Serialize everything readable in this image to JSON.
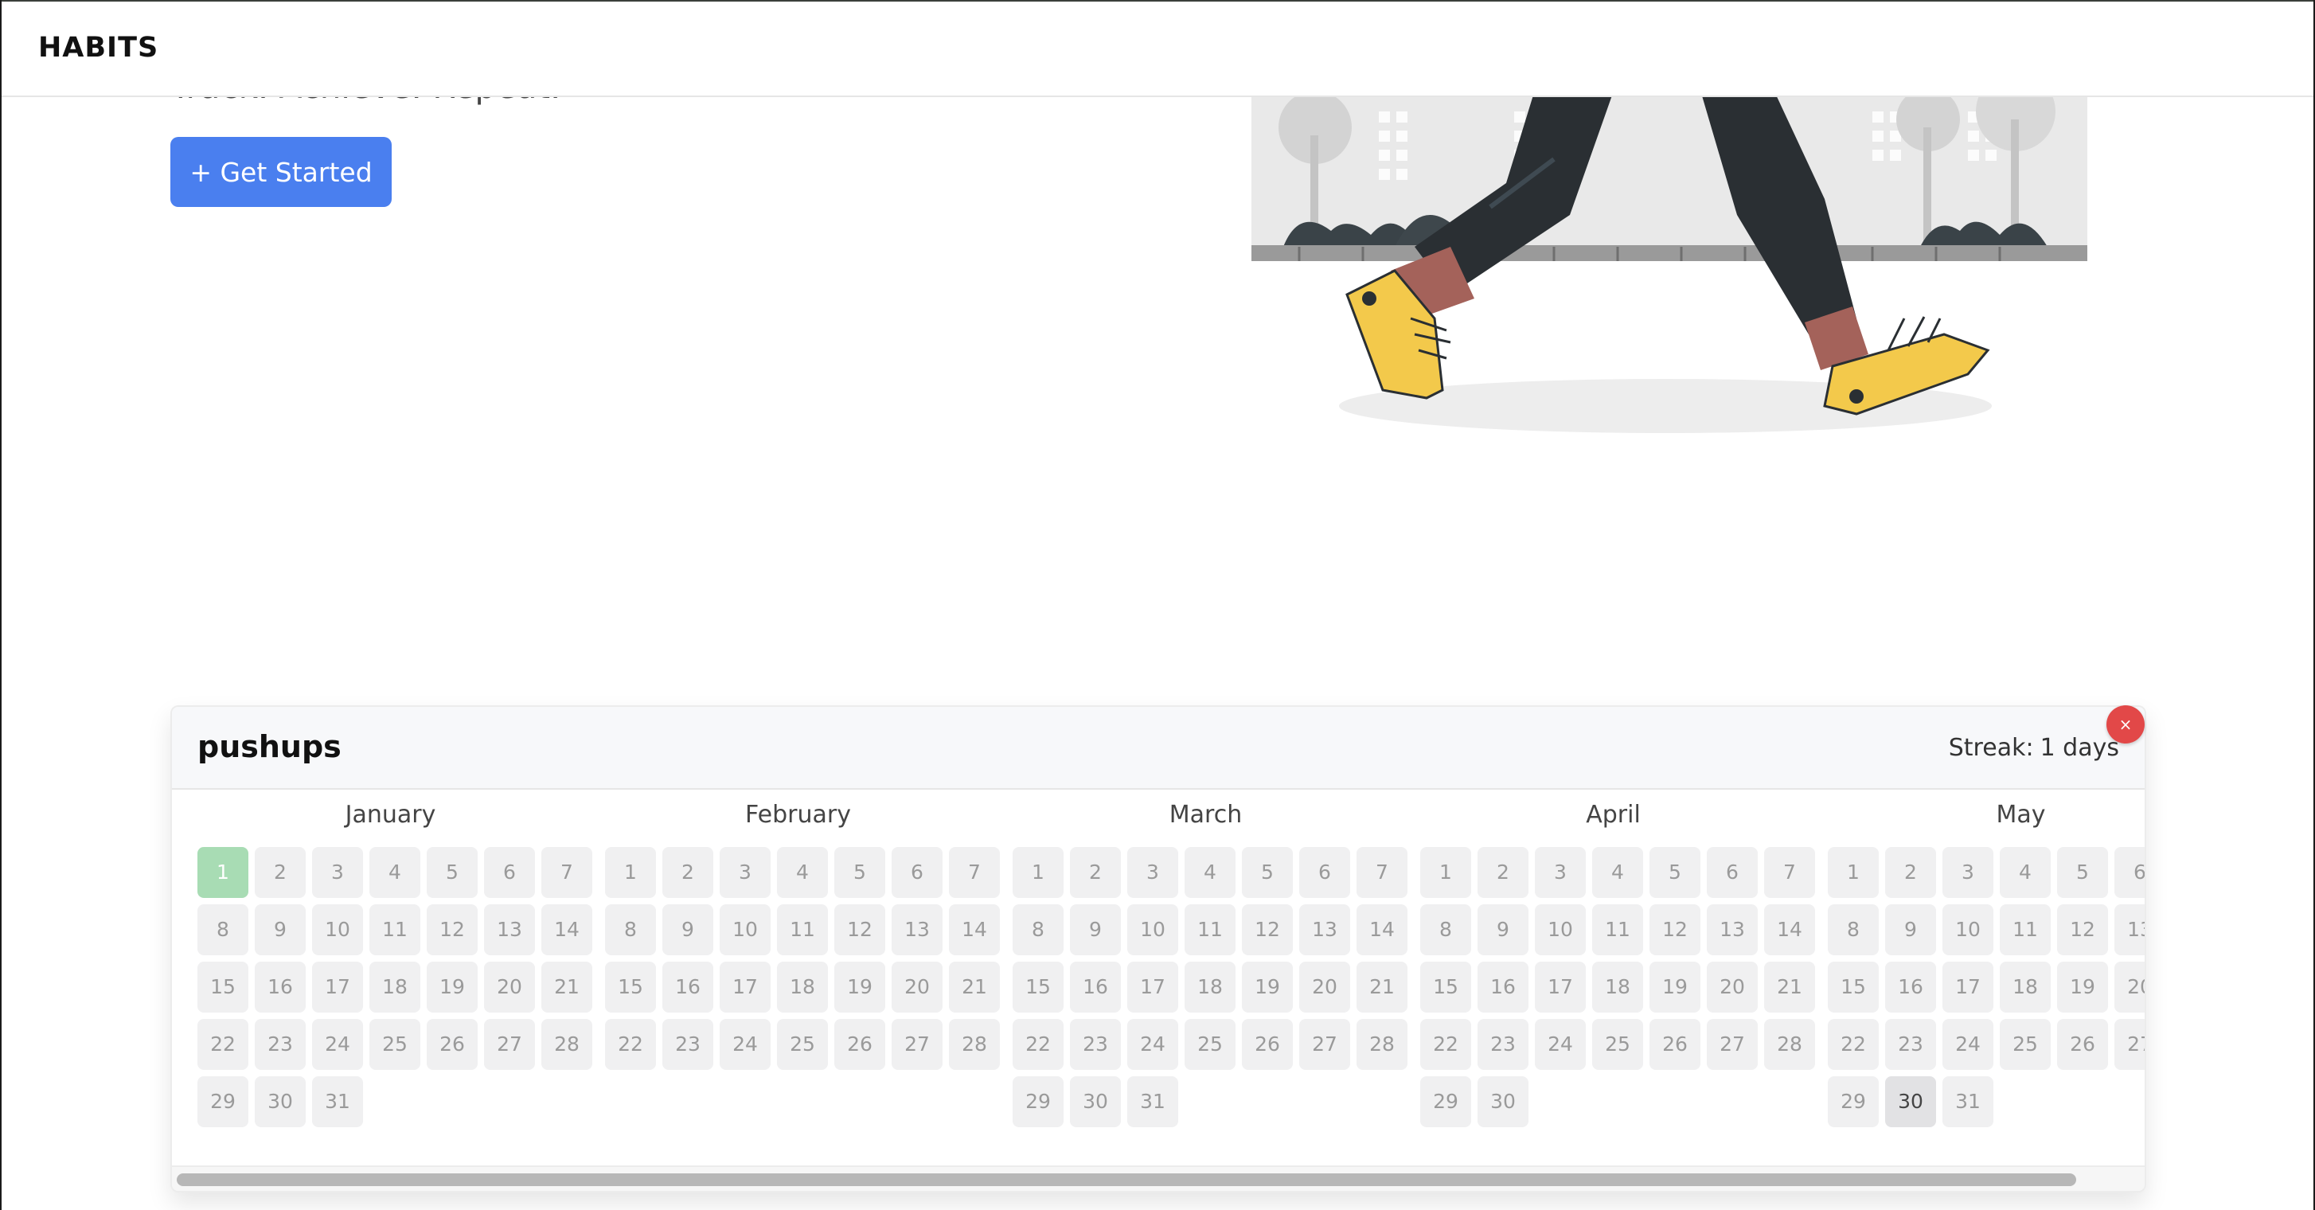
{
  "app": {
    "brand": "HABITS",
    "tagline": "Track. Achieve. Repeat.",
    "cta_label": "+ Get Started"
  },
  "habit": {
    "name": "pushups",
    "streak_label": "Streak:",
    "streak_value": "1 days",
    "delete_label": "×",
    "completed_days": [
      {
        "month": "January",
        "day": 1
      }
    ],
    "today": {
      "month": "May",
      "day": 30
    }
  },
  "months": [
    {
      "name": "January",
      "days": 31
    },
    {
      "name": "February",
      "days": 28
    },
    {
      "name": "March",
      "days": 31
    },
    {
      "name": "April",
      "days": 30
    },
    {
      "name": "May",
      "days": 31
    }
  ],
  "colors": {
    "accent": "#4a7fef",
    "done": "#a8dcb4",
    "delete": "#e24848",
    "shoe": "#f3c94b",
    "pants": "#2a2f33"
  }
}
